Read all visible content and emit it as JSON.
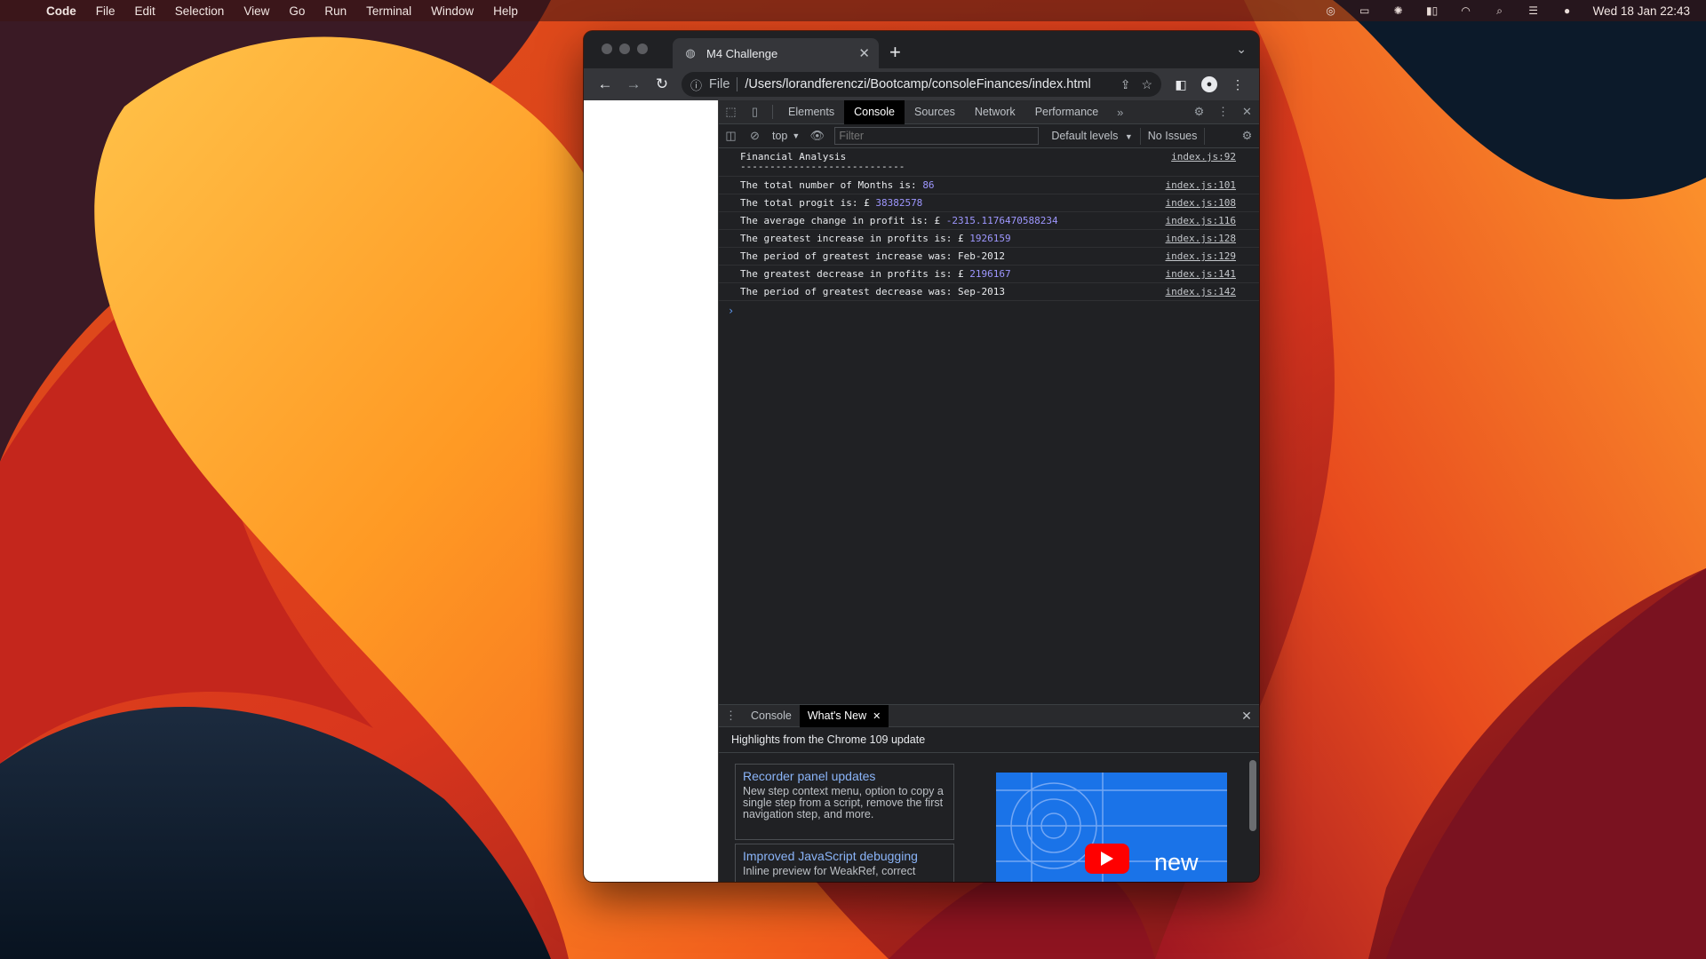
{
  "menubar": {
    "app": "Code",
    "items": [
      "File",
      "Edit",
      "Selection",
      "View",
      "Go",
      "Run",
      "Terminal",
      "Window",
      "Help"
    ],
    "clock": "Wed 18 Jan  22:43"
  },
  "browser": {
    "tab_title": "M4 Challenge",
    "scheme_label": "File",
    "url": "/Users/lorandferenczi/Bootcamp/consoleFinances/index.html"
  },
  "devtools": {
    "tabs": [
      "Elements",
      "Console",
      "Sources",
      "Network",
      "Performance"
    ],
    "active_tab": "Console",
    "context": "top",
    "filter_placeholder": "Filter",
    "levels": "Default levels",
    "issues": "No Issues",
    "logs": [
      {
        "text": "Financial Analysis",
        "value": "",
        "source": "index.js:92"
      },
      {
        "text": "The total number of Months is:",
        "value": "86",
        "source": "index.js:101"
      },
      {
        "text": "The total progit is: £",
        "value": "38382578",
        "source": "index.js:108"
      },
      {
        "text": "The average change in profit is: £",
        "value": "-2315.1176470588234",
        "source": "index.js:116"
      },
      {
        "text": "The greatest increase in profits is: £",
        "value": "1926159",
        "source": "index.js:128"
      },
      {
        "text": "The period of greatest increase was: Feb-2012",
        "value": "",
        "source": "index.js:129"
      },
      {
        "text": "The greatest decrease in profits is: £",
        "value": "2196167",
        "source": "index.js:141"
      },
      {
        "text": "The period of greatest decrease was: Sep-2013",
        "value": "",
        "source": "index.js:142"
      }
    ],
    "dashes": "----------------------------",
    "drawer": {
      "tabs": [
        "Console",
        "What's New"
      ],
      "active": "What's New",
      "header": "Highlights from the Chrome 109 update",
      "cards": [
        {
          "title": "Recorder panel updates",
          "desc": "New step context menu, option to copy a single step from a script, remove the first navigation step, and more."
        },
        {
          "title": "Improved JavaScript debugging",
          "desc": "Inline preview for WeakRef, correct"
        }
      ],
      "video_label": "new"
    }
  }
}
